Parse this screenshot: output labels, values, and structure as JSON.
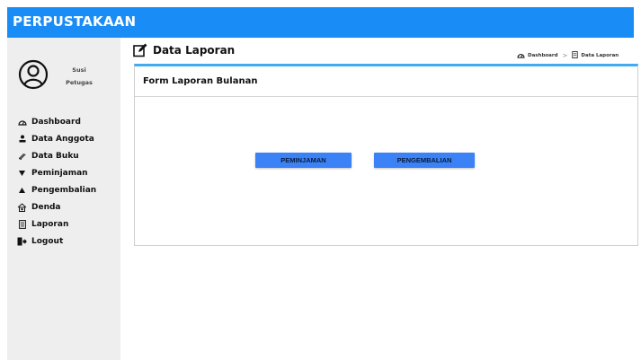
{
  "app": {
    "title": "PERPUSTAKAAN"
  },
  "user": {
    "name": "Susi",
    "role": "Petugas"
  },
  "sidebar": {
    "items": [
      {
        "label": "Dashboard",
        "icon": "dashboard-icon"
      },
      {
        "label": "Data Anggota",
        "icon": "user-icon"
      },
      {
        "label": "Data Buku",
        "icon": "book-icon"
      },
      {
        "label": "Peminjaman",
        "icon": "triangle-down-icon"
      },
      {
        "label": "Pengembalian",
        "icon": "triangle-up-icon"
      },
      {
        "label": "Denda",
        "icon": "money-icon"
      },
      {
        "label": "Laporan",
        "icon": "document-icon"
      },
      {
        "label": "Logout",
        "icon": "logout-icon"
      }
    ]
  },
  "page": {
    "title": "Data Laporan",
    "breadcrumb": {
      "home": "Dashboard",
      "current": "Data Laporan"
    }
  },
  "form": {
    "title": "Form Laporan Bulanan",
    "buttons": {
      "peminjaman": "PEMINJAMAN",
      "pengembalian": "PENGEMBALIAN"
    }
  },
  "colors": {
    "header": "#1a8cf5",
    "accent": "#42aaf2",
    "button": "#3b82f6",
    "sidebar": "#eeeeee"
  }
}
